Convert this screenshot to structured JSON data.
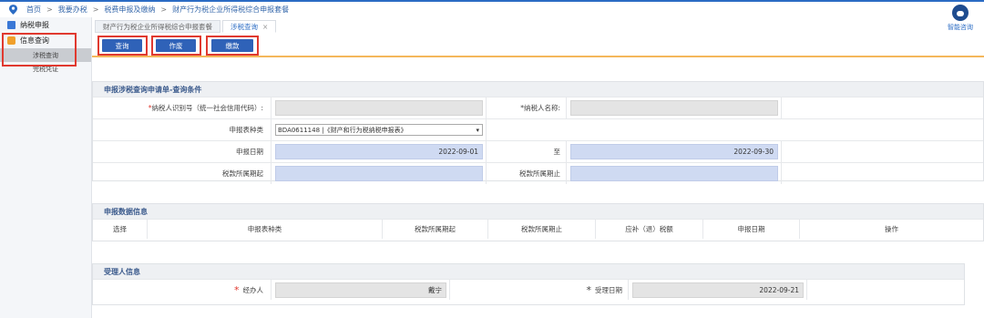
{
  "breadcrumb": [
    "首页",
    "我要办税",
    "税费申报及缴纳",
    "财产行为税企业所得税综合申报套餐"
  ],
  "helper": {
    "label": "智能咨询"
  },
  "sidebar": {
    "items": [
      {
        "label": "纳税申报"
      },
      {
        "label": "信息查询"
      }
    ],
    "subitems": [
      {
        "label": "涉税查询"
      },
      {
        "label": "完税凭证"
      }
    ]
  },
  "tabs": [
    {
      "label": "财产行为税企业所得税综合申报套餐"
    },
    {
      "label": "涉税查询",
      "close": "×"
    }
  ],
  "toolbar": {
    "query": "查询",
    "void": "作废",
    "pay": "缴款"
  },
  "query_panel": {
    "title": "申报涉税查询申请单-查询条件",
    "taxpayer_id_label": "纳税人识别号（统一社会信用代码）:",
    "taxpayer_name_label": "纳税人名称:",
    "form_type_label": "申报表种类",
    "form_type_value": "BDA0611148 |《财产和行为税纳税申报表》",
    "report_date_label": "申报日期",
    "report_date_from": "2022-09-01",
    "to_label": "至",
    "report_date_to": "2022-09-30",
    "period_start_label": "税款所属期起",
    "period_end_label": "税款所属期止"
  },
  "data_panel": {
    "title": "申报数据信息",
    "columns": [
      "选择",
      "申报表种类",
      "税款所属期起",
      "税款所属期止",
      "应补（退）税额",
      "申报日期",
      "操作"
    ]
  },
  "acceptor_panel": {
    "title": "受理人信息",
    "handler_label": "经办人",
    "handler_value": "戴宁",
    "accept_date_label": "受理日期",
    "accept_date_value": "2022-09-21"
  },
  "colors": {
    "accent": "#2f62b8",
    "highlight_box": "#e0392f",
    "divider": "#f4b75b"
  }
}
